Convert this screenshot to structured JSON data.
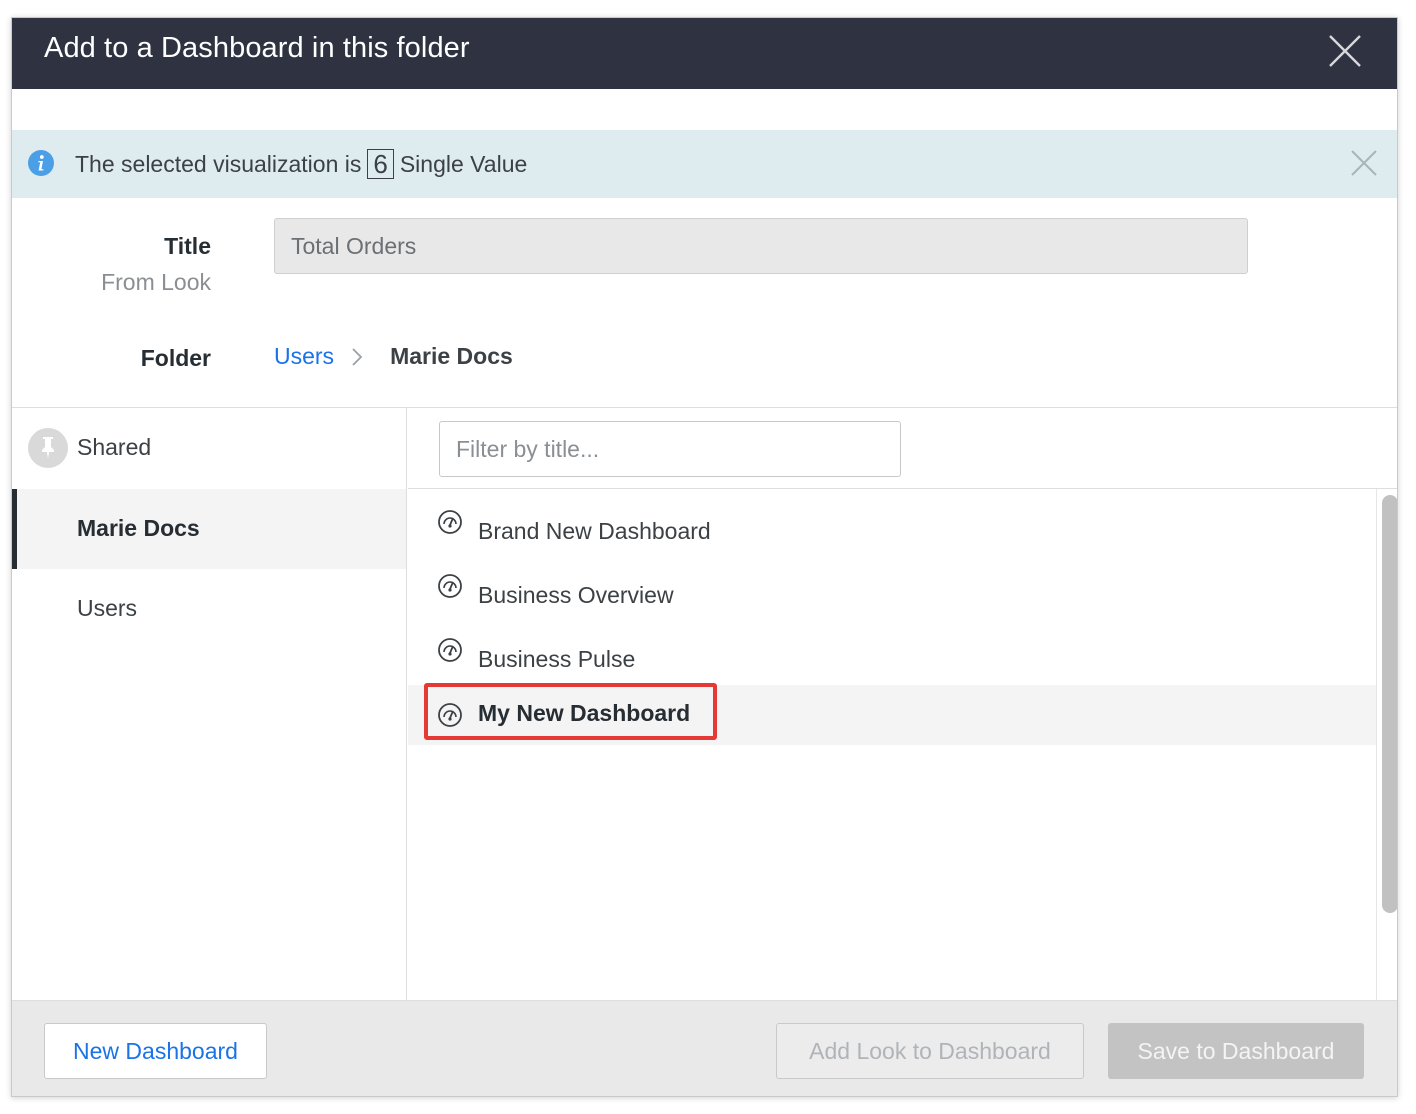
{
  "dialog": {
    "title": "Add to a Dashboard in this folder",
    "close_icon": "close-icon"
  },
  "banner": {
    "icon": "info-icon",
    "text_prefix": "The selected visualization is",
    "viz_glyph": "6",
    "viz_name": "Single Value",
    "close_icon": "close-icon"
  },
  "form": {
    "title_label": "Title",
    "title_sublabel": "From Look",
    "title_value": "Total Orders",
    "folder_label": "Folder",
    "breadcrumb": {
      "parent": "Users",
      "separator_icon": "chevron-right-icon",
      "current": "Marie Docs"
    }
  },
  "sidebar": {
    "items": [
      {
        "label": "Shared",
        "icon": "pin-icon",
        "active": false
      },
      {
        "label": "Marie Docs",
        "active": true
      },
      {
        "label": "Users",
        "active": false
      }
    ]
  },
  "list": {
    "filter_placeholder": "Filter by title...",
    "filter_value": "",
    "item_icon": "dashboard-gauge-icon",
    "items": [
      {
        "label": "Brand New Dashboard",
        "selected": false
      },
      {
        "label": "Business Overview",
        "selected": false
      },
      {
        "label": "Business Pulse",
        "selected": false
      },
      {
        "label": "My New Dashboard",
        "selected": true
      }
    ]
  },
  "footer": {
    "new_dashboard": "New Dashboard",
    "add_look": "Add Look to Dashboard",
    "save": "Save to Dashboard"
  },
  "colors": {
    "header_bg": "#2f3240",
    "banner_bg": "#deecef",
    "link": "#1a73e8",
    "highlight": "#e53935",
    "info": "#4a9fe6"
  }
}
